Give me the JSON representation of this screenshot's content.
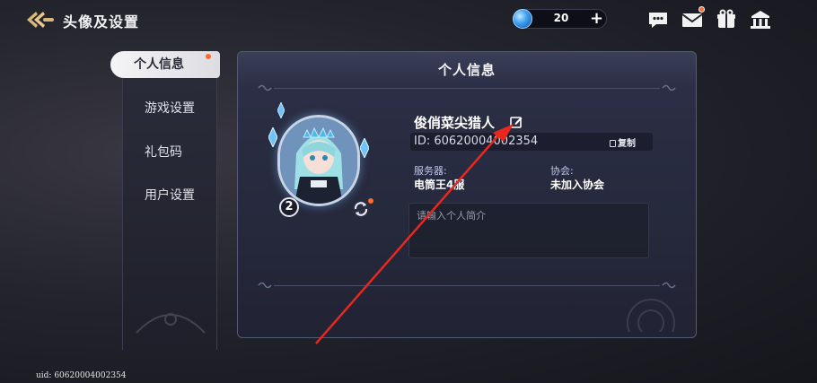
{
  "header": {
    "title": "头像及设置",
    "back_icon": "back-arrow-icon",
    "currency": {
      "value": "20",
      "icon": "gem-icon",
      "add_icon": "plus-icon"
    },
    "icons": [
      "chat-icon",
      "mail-icon",
      "gift-icon",
      "bank-icon"
    ]
  },
  "sidebar": {
    "items": [
      {
        "label": "个人信息",
        "active": true
      },
      {
        "label": "游戏设置",
        "active": false
      },
      {
        "label": "礼包码",
        "active": false
      },
      {
        "label": "用户设置",
        "active": false
      }
    ]
  },
  "profile": {
    "panel_title": "个人信息",
    "nickname": "俊俏菜尖猎人",
    "id_text": "ID: 60620004002354",
    "copy_label": "复制",
    "level": "2",
    "server_label": "服务器:",
    "server_value": "电筒王4服",
    "guild_label": "协会:",
    "guild_value": "未加入协会",
    "bio_placeholder": "请输入个人简介"
  },
  "footer": {
    "uid": "uid: 60620004002354"
  },
  "colors": {
    "accent_dot": "#ff6a2b",
    "annotation_arrow": "#e8271f",
    "panel_bg": "#2d3047"
  }
}
